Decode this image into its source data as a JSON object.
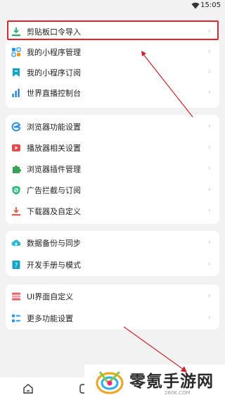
{
  "status": {
    "time": "15:05"
  },
  "section1": [
    {
      "label": "剪贴板口令导入",
      "icon": "import-icon",
      "color": "#2aae67"
    },
    {
      "label": "我的小程序管理",
      "icon": "apps-grid-icon",
      "color": "#2196f3"
    },
    {
      "label": "我的小程序订阅",
      "icon": "bookmark-icon",
      "color": "#17a2c8"
    },
    {
      "label": "世界直播控制台",
      "icon": "console-icon",
      "color": "#1976d2"
    }
  ],
  "section2": [
    {
      "label": "浏览器功能设置",
      "icon": "browser-icon",
      "color": "#2b8de0"
    },
    {
      "label": "播放器相关设置",
      "icon": "video-play-icon",
      "color": "#e84848"
    },
    {
      "label": "浏览器插件管理",
      "icon": "puzzle-icon",
      "color": "#3aa15a"
    },
    {
      "label": "广告拦截与订阅",
      "icon": "shield-block-icon",
      "color": "#22b573"
    },
    {
      "label": "下载器及自定义",
      "icon": "download-icon",
      "color": "#e25b4b"
    }
  ],
  "section3": [
    {
      "label": "数据备份与同步",
      "icon": "cloud-sync-icon",
      "color": "#2bb5d6"
    },
    {
      "label": "开发手册与模式",
      "icon": "help-book-icon",
      "color": "#17a2c8"
    }
  ],
  "section4": [
    {
      "label": "UI界面自定义",
      "icon": "ui-custom-icon",
      "color": "#e4606d"
    },
    {
      "label": "更多功能设置",
      "icon": "more-settings-icon",
      "color": "#2196f3"
    }
  ],
  "chevron": "›",
  "watermark": {
    "title": "零氪手游网",
    "sub": "260K.COM"
  },
  "colors": {
    "accent_red": "#e2232a",
    "background": "#f2f2f2"
  }
}
